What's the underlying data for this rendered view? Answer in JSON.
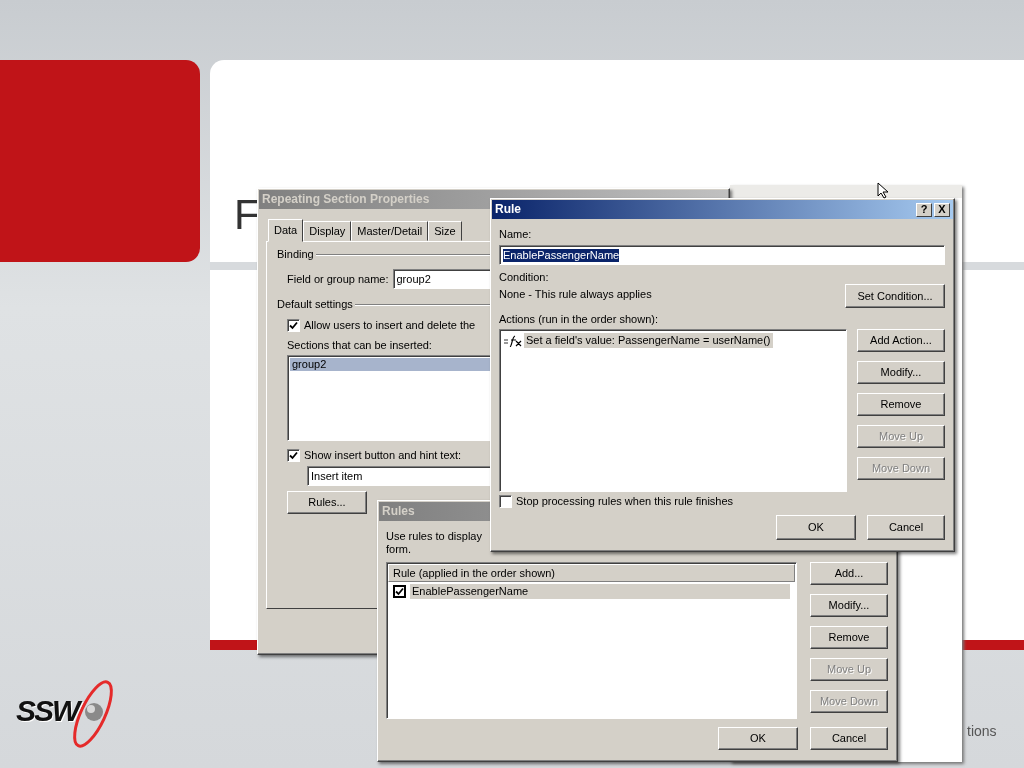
{
  "slide": {
    "title": "F",
    "footer_text": "tions",
    "logo_text": "SSW"
  },
  "properties_dialog": {
    "title": "Repeating Section Properties",
    "active": false,
    "tabs": [
      {
        "label": "Data",
        "selected": true
      },
      {
        "label": "Display",
        "selected": false
      },
      {
        "label": "Master/Detail",
        "selected": false
      },
      {
        "label": "Size",
        "selected": false
      }
    ],
    "binding_legend": "Binding",
    "field_label": "Field or group name:",
    "field_value": "group2",
    "defaults_legend": "Default settings",
    "allow_insert": {
      "label": "Allow users to insert and delete the",
      "checked": true
    },
    "sections_label": "Sections that can be inserted:",
    "sections": [
      {
        "label": "group2",
        "selected": true
      }
    ],
    "show_insert": {
      "label": "Show insert button and hint text:",
      "checked": true
    },
    "hint_value": "Insert item",
    "rules_button": "Rules..."
  },
  "rules_dialog": {
    "title": "Rules",
    "active": false,
    "intro": [
      "Use rules to display",
      "form."
    ],
    "column": "Rule (applied in the order shown)",
    "rules": [
      {
        "name": "EnablePassengerName",
        "checked": true,
        "selected": true
      }
    ],
    "buttons": [
      {
        "label": "Add...",
        "disabled": false
      },
      {
        "label": "Modify...",
        "disabled": false
      },
      {
        "label": "Remove",
        "disabled": false
      },
      {
        "label": "Move Up",
        "disabled": true
      },
      {
        "label": "Move Down",
        "disabled": true
      }
    ],
    "ok": "OK",
    "cancel": "Cancel"
  },
  "rule_dialog": {
    "title": "Rule",
    "active": true,
    "title_buttons": [
      "?",
      "X"
    ],
    "name_label": "Name:",
    "name_value": "EnablePassengerName",
    "name_selected": true,
    "condition_label": "Condition:",
    "condition_text": "None - This rule always applies",
    "set_condition": "Set Condition...",
    "actions_label": "Actions (run in the order shown):",
    "actions": [
      {
        "text": "Set a field's value: PassengerName = userName()",
        "selected": true
      }
    ],
    "buttons": [
      {
        "label": "Add Action...",
        "disabled": false
      },
      {
        "label": "Modify...",
        "disabled": false
      },
      {
        "label": "Remove",
        "disabled": false
      },
      {
        "label": "Move Up",
        "disabled": true
      },
      {
        "label": "Move Down",
        "disabled": true
      }
    ],
    "stop": {
      "label": "Stop processing rules when this rule finishes",
      "checked": false
    },
    "ok": "OK",
    "cancel": "Cancel"
  }
}
